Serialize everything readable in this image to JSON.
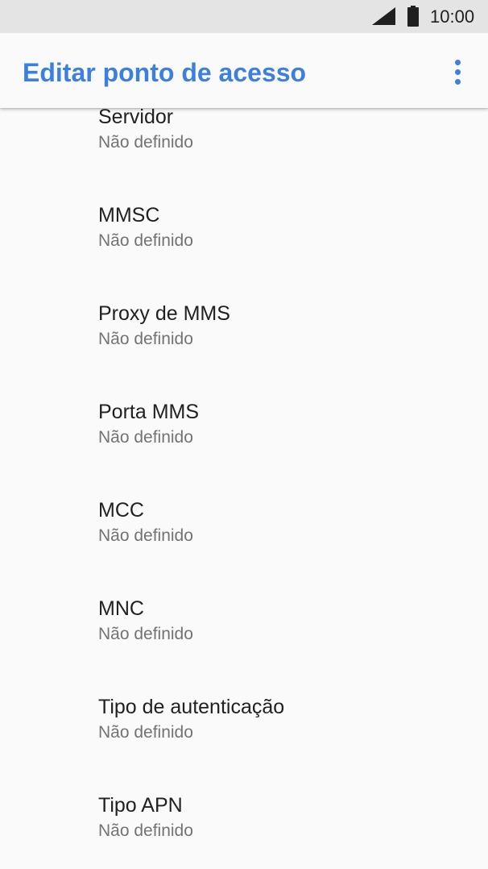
{
  "status_bar": {
    "time": "10:00",
    "icons": [
      "signal-icon",
      "battery-icon"
    ]
  },
  "app_bar": {
    "title": "Editar ponto de acesso",
    "menu_icon": "more-vert-icon",
    "accent_color": "#3d7fdc"
  },
  "preferences": [
    {
      "title": "Servidor",
      "summary": "Não definido"
    },
    {
      "title": "MMSC",
      "summary": "Não definido"
    },
    {
      "title": "Proxy de MMS",
      "summary": "Não definido"
    },
    {
      "title": "Porta MMS",
      "summary": "Não definido"
    },
    {
      "title": "MCC",
      "summary": "Não definido"
    },
    {
      "title": "MNC",
      "summary": "Não definido"
    },
    {
      "title": "Tipo de autenticação",
      "summary": "Não definido"
    },
    {
      "title": "Tipo APN",
      "summary": "Não definido"
    }
  ]
}
